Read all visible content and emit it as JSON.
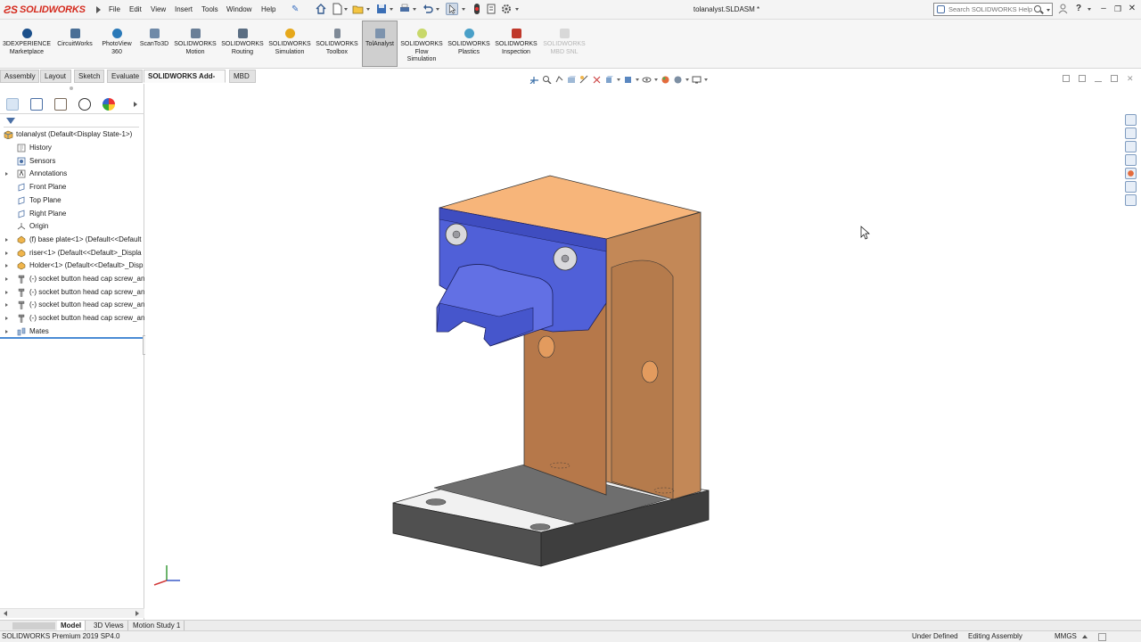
{
  "app": {
    "brand": "SOLIDWORKS",
    "document_title": "tolanalyst.SLDASM *"
  },
  "menu": [
    "File",
    "Edit",
    "View",
    "Insert",
    "Tools",
    "Window",
    "Help"
  ],
  "search": {
    "placeholder": "Search SOLIDWORKS Help"
  },
  "ribbon": {
    "items": [
      {
        "label1": "3DEXPERIENCE",
        "label2": "Marketplace",
        "label3": ""
      },
      {
        "label1": "CircuitWorks",
        "label2": "",
        "label3": ""
      },
      {
        "label1": "PhotoView",
        "label2": "360",
        "label3": ""
      },
      {
        "label1": "ScanTo3D",
        "label2": "",
        "label3": ""
      },
      {
        "label1": "SOLIDWORKS",
        "label2": "Motion",
        "label3": ""
      },
      {
        "label1": "SOLIDWORKS",
        "label2": "Routing",
        "label3": ""
      },
      {
        "label1": "SOLIDWORKS",
        "label2": "Simulation",
        "label3": ""
      },
      {
        "label1": "SOLIDWORKS",
        "label2": "Toolbox",
        "label3": ""
      },
      {
        "label1": "TolAnalyst",
        "label2": "",
        "label3": ""
      },
      {
        "label1": "SOLIDWORKS",
        "label2": "Flow",
        "label3": "Simulation"
      },
      {
        "label1": "SOLIDWORKS",
        "label2": "Plastics",
        "label3": ""
      },
      {
        "label1": "SOLIDWORKS",
        "label2": "Inspection",
        "label3": ""
      },
      {
        "label1": "SOLIDWORKS",
        "label2": "MBD SNL",
        "label3": ""
      }
    ],
    "active_item": "TolAnalyst",
    "disabled_item": "SOLIDWORKS MBD SNL"
  },
  "cm_tabs": [
    "Assembly",
    "Layout",
    "Sketch",
    "Evaluate",
    "SOLIDWORKS Add-Ins",
    "MBD"
  ],
  "cm_active_tab": "SOLIDWORKS Add-Ins",
  "feature_tree": {
    "root": "tolanalyst  (Default<Display State-1>)",
    "items": [
      {
        "label": "History",
        "icon": "history-icon",
        "expandable": false
      },
      {
        "label": "Sensors",
        "icon": "sensors-icon",
        "expandable": false
      },
      {
        "label": "Annotations",
        "icon": "annotations-icon",
        "expandable": true
      },
      {
        "label": "Front Plane",
        "icon": "plane-icon",
        "expandable": false
      },
      {
        "label": "Top Plane",
        "icon": "plane-icon",
        "expandable": false
      },
      {
        "label": "Right Plane",
        "icon": "plane-icon",
        "expandable": false
      },
      {
        "label": "Origin",
        "icon": "origin-icon",
        "expandable": false
      },
      {
        "label": "(f) base plate<1> (Default<<Default",
        "icon": "part-icon",
        "expandable": true
      },
      {
        "label": "riser<1> (Default<<Default>_Displa",
        "icon": "part-icon",
        "expandable": true
      },
      {
        "label": "Holder<1> (Default<<Default>_Disp",
        "icon": "part-icon",
        "expandable": true
      },
      {
        "label": "(-) socket button head cap screw_an",
        "icon": "screw-icon",
        "expandable": true
      },
      {
        "label": "(-) socket button head cap screw_an",
        "icon": "screw-icon",
        "expandable": true
      },
      {
        "label": "(-) socket button head cap screw_an",
        "icon": "screw-icon",
        "expandable": true
      },
      {
        "label": "(-) socket button head cap screw_an",
        "icon": "screw-icon",
        "expandable": true
      },
      {
        "label": "Mates",
        "icon": "mates-icon",
        "expandable": true
      }
    ]
  },
  "bottom_tabs": [
    "Model",
    "3D Views",
    "Motion Study 1"
  ],
  "bottom_active_tab": "Model",
  "status": {
    "version": "SOLIDWORKS Premium 2019 SP4.0",
    "definition": "Under Defined",
    "mode": "Editing Assembly",
    "units": "MMGS"
  },
  "colors": {
    "base_plate_top": "#f1f1f1",
    "base_plate_side": "#4c4c4c",
    "riser": "#b97f4c",
    "riser_top": "#f7b57a",
    "holder": "#5060d8",
    "accent_brand": "#d52b1e"
  }
}
